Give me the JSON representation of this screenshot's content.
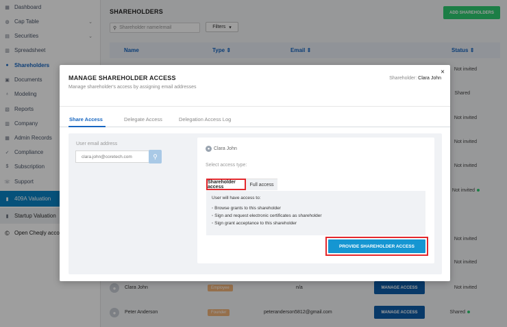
{
  "sidebar": {
    "items": [
      {
        "label": "Dashboard",
        "icon": "dashboard-icon"
      },
      {
        "label": "Cap Table",
        "icon": "cap-table-icon"
      },
      {
        "label": "Securities",
        "icon": "securities-icon"
      },
      {
        "label": "Spreadsheet",
        "icon": "spreadsheet-icon"
      },
      {
        "label": "Shareholders",
        "icon": "shareholders-icon"
      },
      {
        "label": "Documents",
        "icon": "documents-icon"
      },
      {
        "label": "Modeling",
        "icon": "modeling-icon"
      },
      {
        "label": "Reports",
        "icon": "reports-icon"
      },
      {
        "label": "Company",
        "icon": "company-icon"
      },
      {
        "label": "Admin Records",
        "icon": "admin-records-icon"
      },
      {
        "label": "Compliance",
        "icon": "compliance-icon"
      },
      {
        "label": "Subscription",
        "icon": "subscription-icon"
      },
      {
        "label": "Support",
        "icon": "support-icon"
      }
    ],
    "valuation_label": "409A Valuation",
    "startup_label": "Startup Valuation",
    "open_label": "Open Cheqly acco"
  },
  "header": {
    "title": "SHAREHOLDERS",
    "add_button": "ADD SHAREHOLDERS",
    "search_placeholder": "Shareholder name/email",
    "filters_label": "Filters"
  },
  "table": {
    "columns": [
      "Name",
      "Type",
      "Email",
      "Status"
    ],
    "status_column": [
      "Not invited",
      "Shared",
      "Not invited",
      "Not invited",
      "Not invited",
      "Not invited",
      "Not invited",
      "Not invited",
      "Not invited"
    ],
    "rows": [
      {
        "name": "Clara John",
        "type": "Employee",
        "email": "n/a",
        "action": "MANAGE ACCESS",
        "status": "Not invited",
        "type_color": "#f0b37a"
      },
      {
        "name": "Peter Anderson",
        "type": "Founder",
        "email": "peteranderson5812@gmail.com",
        "action": "MANAGE ACCESS",
        "status": "Shared",
        "type_color": "#f0b37a"
      }
    ]
  },
  "modal": {
    "title": "MANAGE SHAREHOLDER ACCESS",
    "subtitle": "Manage shareholder's access by assigning email addresses",
    "holder_prefix": "Shareholder:",
    "holder_name": "Clara John",
    "close": "×",
    "tabs": [
      "Share Access",
      "Delegate Access",
      "Delegation Access Log"
    ],
    "email_label": "User email address",
    "email_value": "clara.john@coretech.com",
    "card_user": "Clara John",
    "access_type_label": "Select access type:",
    "access_tabs": [
      "Shareholder access",
      "Full access"
    ],
    "access_intro": "User will have access to:",
    "access_items": [
      "Browse grants to this shareholder",
      "Sign and request electronic certificates as shareholder",
      "Sign grant acceptance to this shareholder"
    ],
    "provide_button": "PROVIDE SHAREHOLDER ACCESS"
  },
  "colors": {
    "accent": "#1565c0",
    "primary_button": "#1596d2",
    "highlight": "#e3262b",
    "success": "#2ecc71"
  }
}
